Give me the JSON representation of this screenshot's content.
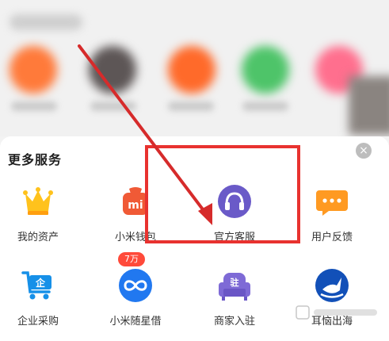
{
  "panel": {
    "title": "更多服务",
    "close_glyph": "×",
    "services": [
      {
        "label": "我的资产",
        "icon": "crown-icon"
      },
      {
        "label": "小米钱包",
        "icon": "wallet-icon",
        "icon_text": "mi"
      },
      {
        "label": "官方客服",
        "icon": "headset-icon"
      },
      {
        "label": "用户反馈",
        "icon": "chat-bubble-icon"
      },
      {
        "label": "企业采购",
        "icon": "shopping-cart-icon",
        "icon_text": "企"
      },
      {
        "label": "小米随星借",
        "icon": "infinity-icon",
        "badge": "7万"
      },
      {
        "label": "商家入驻",
        "icon": "sofa-icon",
        "icon_text": "驻"
      },
      {
        "label": "耳恼出海",
        "icon": "boat-icon"
      }
    ]
  },
  "colors": {
    "highlight": "#e8322f",
    "arrow": "#d62b2b",
    "headset": "#6a5ac8",
    "badge": "#ff4a3a"
  }
}
